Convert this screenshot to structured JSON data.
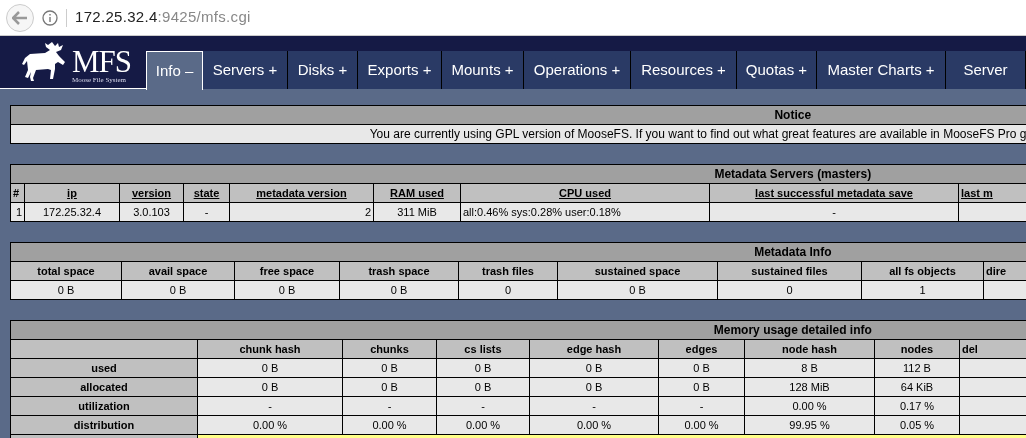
{
  "browser": {
    "url_host": "172.25.32.4",
    "url_rest": ":9425/mfs.cgi"
  },
  "logo": {
    "title": "MFS",
    "subtitle": "Moose File System"
  },
  "tabs": [
    {
      "label": "Info –",
      "selected": true
    },
    {
      "label": "Servers +",
      "selected": false
    },
    {
      "label": "Disks +",
      "selected": false
    },
    {
      "label": "Exports +",
      "selected": false
    },
    {
      "label": "Mounts +",
      "selected": false
    },
    {
      "label": "Operations +",
      "selected": false
    },
    {
      "label": "Resources +",
      "selected": false
    },
    {
      "label": "Quotas +",
      "selected": false
    },
    {
      "label": "Master Charts +",
      "selected": false
    },
    {
      "label": "Server",
      "selected": false
    }
  ],
  "notice": {
    "title": "Notice",
    "text": "You are currently using GPL version of MooseFS. If you want to find out what great features are available in MooseFS Pro g"
  },
  "metadata_servers": {
    "title": "Metadata Servers (masters)",
    "columns": [
      "#",
      "ip",
      "version",
      "state",
      "metadata version",
      "RAM used",
      "CPU used",
      "last successful metadata save",
      "last m"
    ],
    "rows": [
      [
        "1",
        "172.25.32.4",
        "3.0.103",
        "-",
        "2",
        "311 MiB",
        "all:0.46% sys:0.28% user:0.18%",
        "-"
      ]
    ]
  },
  "metadata_info": {
    "title": "Metadata Info",
    "columns": [
      "total space",
      "avail space",
      "free space",
      "trash space",
      "trash files",
      "sustained space",
      "sustained files",
      "all fs objects",
      "dire"
    ],
    "rows": [
      [
        "0 B",
        "0 B",
        "0 B",
        "0 B",
        "0",
        "0 B",
        "0",
        "1"
      ]
    ]
  },
  "memory_usage": {
    "title": "Memory usage detailed info",
    "columns": [
      "chunk hash",
      "chunks",
      "cs lists",
      "edge hash",
      "edges",
      "node hash",
      "nodes",
      "del"
    ],
    "rows": [
      {
        "label": "used",
        "cells": [
          "0 B",
          "0 B",
          "0 B",
          "0 B",
          "0 B",
          "8 B",
          "112 B"
        ]
      },
      {
        "label": "allocated",
        "cells": [
          "0 B",
          "0 B",
          "0 B",
          "0 B",
          "0 B",
          "128 MiB",
          "64 KiB"
        ]
      },
      {
        "label": "utilization",
        "cells": [
          "-",
          "-",
          "-",
          "-",
          "-",
          "0.00 %",
          "0.17 %"
        ]
      },
      {
        "label": "distribution",
        "cells": [
          "0.00 %",
          "0.00 %",
          "0.00 %",
          "0.00 %",
          "0.00 %",
          "99.95 %",
          "0.05 %"
        ]
      }
    ]
  }
}
